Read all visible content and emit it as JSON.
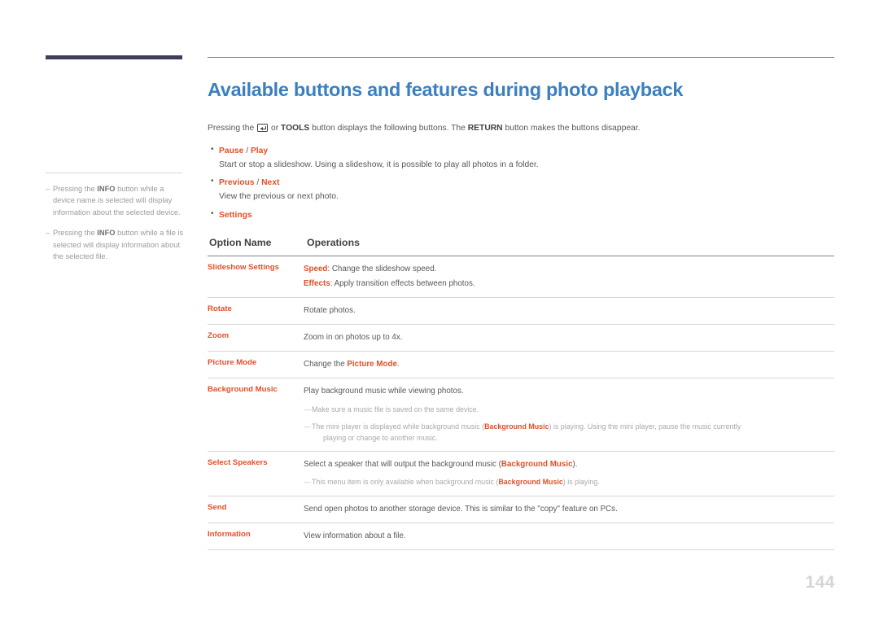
{
  "page": {
    "number": "144",
    "title": "Available buttons and features during photo playback"
  },
  "colors": {
    "heading_blue": "#3a80c1",
    "accent_orange": "#e0502a",
    "body_gray": "#58585b",
    "rule_gray": "#d6d7d9",
    "topbar_navy": "#3f3f5c",
    "page_number_gray": "#d4d5d7"
  },
  "intro": {
    "part1": "Pressing the ",
    "icon": "enter-key-icon",
    "part2": " or ",
    "bold1": "TOOLS",
    "part3": " button displays the following buttons. The ",
    "bold2": "RETURN",
    "part4": " button makes the buttons disappear."
  },
  "sidebar": {
    "notes": [
      {
        "dash": "–",
        "pre": "Pressing the ",
        "bold": "INFO",
        "post": " button while a device name is selected will display information about the selected device."
      },
      {
        "dash": "–",
        "pre": "Pressing the ",
        "bold": "INFO",
        "post": " button while a file is selected will display information about the selected file."
      }
    ]
  },
  "bullets": [
    {
      "marker": "•",
      "label_a": "Pause",
      "separator": " / ",
      "label_b": "Play",
      "desc": "Start or stop a slideshow. Using a slideshow, it is possible to play all photos in a folder."
    },
    {
      "marker": "•",
      "label_a": "Previous",
      "separator": " / ",
      "label_b": "Next",
      "desc": "View the previous or next photo."
    },
    {
      "marker": "•",
      "label_a": "Settings",
      "separator": "",
      "label_b": "",
      "desc": ""
    }
  ],
  "table": {
    "headers": {
      "option_name": "Option Name",
      "operations": "Operations"
    },
    "rows": {
      "slideshow": {
        "name": "Slideshow Settings",
        "line1_bold": "Speed",
        "line1_rest": ": Change the slideshow speed.",
        "line2_bold": "Effects",
        "line2_rest": ": Apply transition effects between photos."
      },
      "rotate": {
        "name": "Rotate",
        "text": "Rotate photos."
      },
      "zoom": {
        "name": "Zoom",
        "text": "Zoom in on photos up to 4x."
      },
      "picture_mode": {
        "name": "Picture Mode",
        "pre": "Change the ",
        "bold": "Picture Mode",
        "post": "."
      },
      "background_music": {
        "name": "Background Music",
        "text": "Play background music while viewing photos.",
        "note1_dash": "—",
        "note1": "Make sure a music file is saved on the same device.",
        "note2_dash": "—",
        "note2_pre": "The mini player is displayed while background music (",
        "note2_bold": "Background Music",
        "note2_post": ") is playing. Using the mini player, pause the music currently",
        "note2_cont": "playing or change to another music."
      },
      "select_speakers": {
        "name": "Select Speakers",
        "pre": "Select a speaker that will output the background music (",
        "bold": "Background Music",
        "post": ").",
        "note_dash": "—",
        "note_pre": "This menu item is only available when background music (",
        "note_bold": "Background Music",
        "note_post": ") is playing."
      },
      "send": {
        "name": "Send",
        "text": "Send open photos to another storage device. This is similar to the \"copy\" feature on PCs."
      },
      "information": {
        "name": "Information",
        "text": "View information about a file."
      }
    }
  }
}
